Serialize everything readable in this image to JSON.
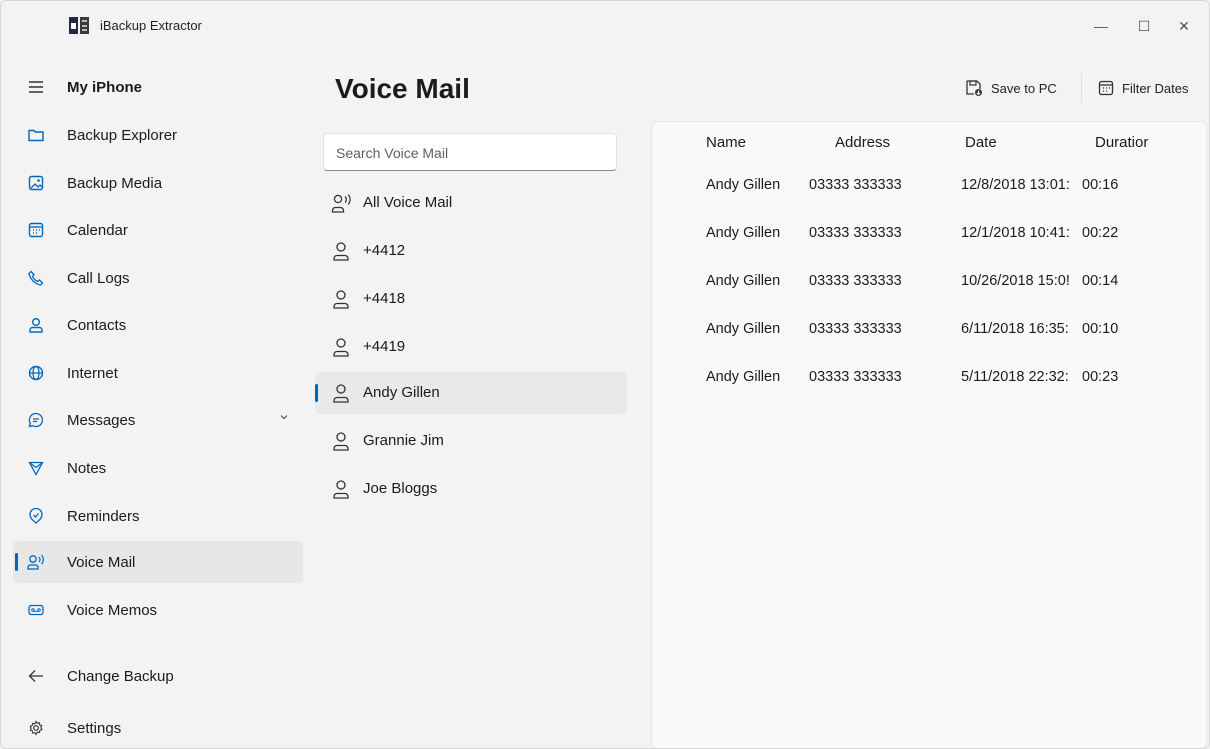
{
  "window": {
    "title": "iBackup Extractor",
    "minimize": "—",
    "maximize": "☐",
    "close": "✕"
  },
  "sidebar": {
    "header": "My iPhone",
    "items": [
      {
        "label": "Backup Explorer",
        "icon": "folder-icon"
      },
      {
        "label": "Backup Media",
        "icon": "image-icon"
      },
      {
        "label": "Calendar",
        "icon": "calendar-icon"
      },
      {
        "label": "Call Logs",
        "icon": "phone-icon"
      },
      {
        "label": "Contacts",
        "icon": "person-icon"
      },
      {
        "label": "Internet",
        "icon": "globe-icon"
      },
      {
        "label": "Messages",
        "icon": "chat-icon"
      },
      {
        "label": "Notes",
        "icon": "notes-icon"
      },
      {
        "label": "Reminders",
        "icon": "reminder-icon"
      },
      {
        "label": "Voice Mail",
        "icon": "voicemail-icon",
        "selected": true
      },
      {
        "label": "Voice Memos",
        "icon": "voice-memo-icon"
      }
    ],
    "change_backup": "Change Backup",
    "settings": "Settings"
  },
  "header": {
    "title": "Voice Mail",
    "save_label": "Save to PC",
    "filter_label": "Filter Dates"
  },
  "voicemail_list": {
    "search_placeholder": "Search Voice Mail",
    "items": [
      {
        "label": "All Voice Mail",
        "icon": "voicemail-person-icon"
      },
      {
        "label": "+4412",
        "icon": "person-icon"
      },
      {
        "label": "+4418",
        "icon": "person-icon"
      },
      {
        "label": "+4419",
        "icon": "person-icon"
      },
      {
        "label": "Andy Gillen",
        "icon": "person-icon",
        "selected": true
      },
      {
        "label": "Grannie Jim",
        "icon": "person-icon"
      },
      {
        "label": "Joe Bloggs",
        "icon": "person-icon"
      }
    ]
  },
  "table": {
    "columns": [
      "Name",
      "Address",
      "Date",
      "Duratior"
    ],
    "rows": [
      {
        "name": "Andy Gillen",
        "address": "03333 333333",
        "date": "12/8/2018 13:01:",
        "duration": "00:16"
      },
      {
        "name": "Andy Gillen",
        "address": "03333 333333",
        "date": "12/1/2018 10:41:",
        "duration": "00:22"
      },
      {
        "name": "Andy Gillen",
        "address": "03333 333333",
        "date": "10/26/2018 15:0!",
        "duration": "00:14"
      },
      {
        "name": "Andy Gillen",
        "address": "03333 333333",
        "date": "6/11/2018 16:35:",
        "duration": "00:10"
      },
      {
        "name": "Andy Gillen",
        "address": "03333 333333",
        "date": "5/11/2018 22:32:",
        "duration": "00:23"
      }
    ]
  },
  "colors": {
    "accent": "#0067c0",
    "background": "#f3f3f3",
    "selected": "#e7e7e7"
  }
}
